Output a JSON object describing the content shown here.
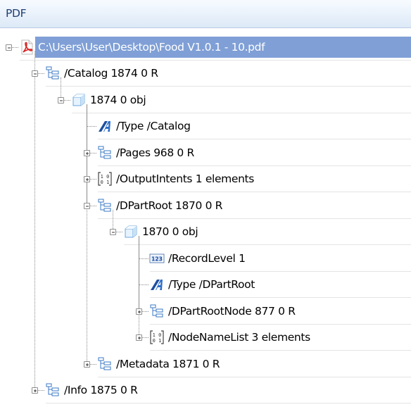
{
  "panel": {
    "title": "PDF"
  },
  "tree": [
    {
      "label": "C:\\Users\\User\\Desktop\\Food V1.0.1 - 10.pdf",
      "level": 0,
      "icon": "pdf-file-icon",
      "expander": "minus",
      "selected": true,
      "name": "tree-node-pdf-file"
    },
    {
      "label": "/Catalog 1874 0 R",
      "level": 1,
      "icon": "dictionary-icon",
      "expander": "minus",
      "name": "tree-node-catalog"
    },
    {
      "label": "1874 0 obj",
      "level": 2,
      "icon": "object-icon",
      "expander": "minus",
      "name": "tree-node-obj-1874"
    },
    {
      "label": "/Type /Catalog",
      "level": 3,
      "icon": "name-icon",
      "expander": "none",
      "name": "tree-node-type-catalog"
    },
    {
      "label": "/Pages 968 0 R",
      "level": 3,
      "icon": "dictionary-icon",
      "expander": "plus",
      "name": "tree-node-pages"
    },
    {
      "label": "/OutputIntents 1 elements",
      "level": 3,
      "icon": "array-icon",
      "expander": "plus",
      "name": "tree-node-outputintents"
    },
    {
      "label": "/DPartRoot 1870 0 R",
      "level": 3,
      "icon": "dictionary-icon",
      "expander": "minus",
      "name": "tree-node-dpartroot"
    },
    {
      "label": "1870 0 obj",
      "level": 4,
      "icon": "object-icon",
      "expander": "minus",
      "name": "tree-node-obj-1870"
    },
    {
      "label": "/RecordLevel 1",
      "level": 5,
      "icon": "number-icon",
      "expander": "none",
      "name": "tree-node-recordlevel"
    },
    {
      "label": "/Type /DPartRoot",
      "level": 5,
      "icon": "name-icon",
      "expander": "none",
      "name": "tree-node-type-dpartroot"
    },
    {
      "label": "/DPartRootNode 877 0 R",
      "level": 5,
      "icon": "dictionary-icon",
      "expander": "plus",
      "name": "tree-node-dpartrootnode"
    },
    {
      "label": "/NodeNameList 3 elements",
      "level": 5,
      "icon": "array-icon",
      "expander": "plus",
      "name": "tree-node-nodenamelist"
    },
    {
      "label": "/Metadata 1871 0 R",
      "level": 3,
      "icon": "dictionary-icon",
      "expander": "plus",
      "name": "tree-node-metadata"
    },
    {
      "label": "/Info 1875 0 R",
      "level": 1,
      "icon": "dictionary-icon",
      "expander": "plus",
      "name": "tree-node-info"
    }
  ],
  "colors": {
    "selection": "#7f9fd6",
    "header_text": "#1e3f73",
    "icon_blue": "#3b78c4",
    "pdf_red": "#d6201f"
  }
}
